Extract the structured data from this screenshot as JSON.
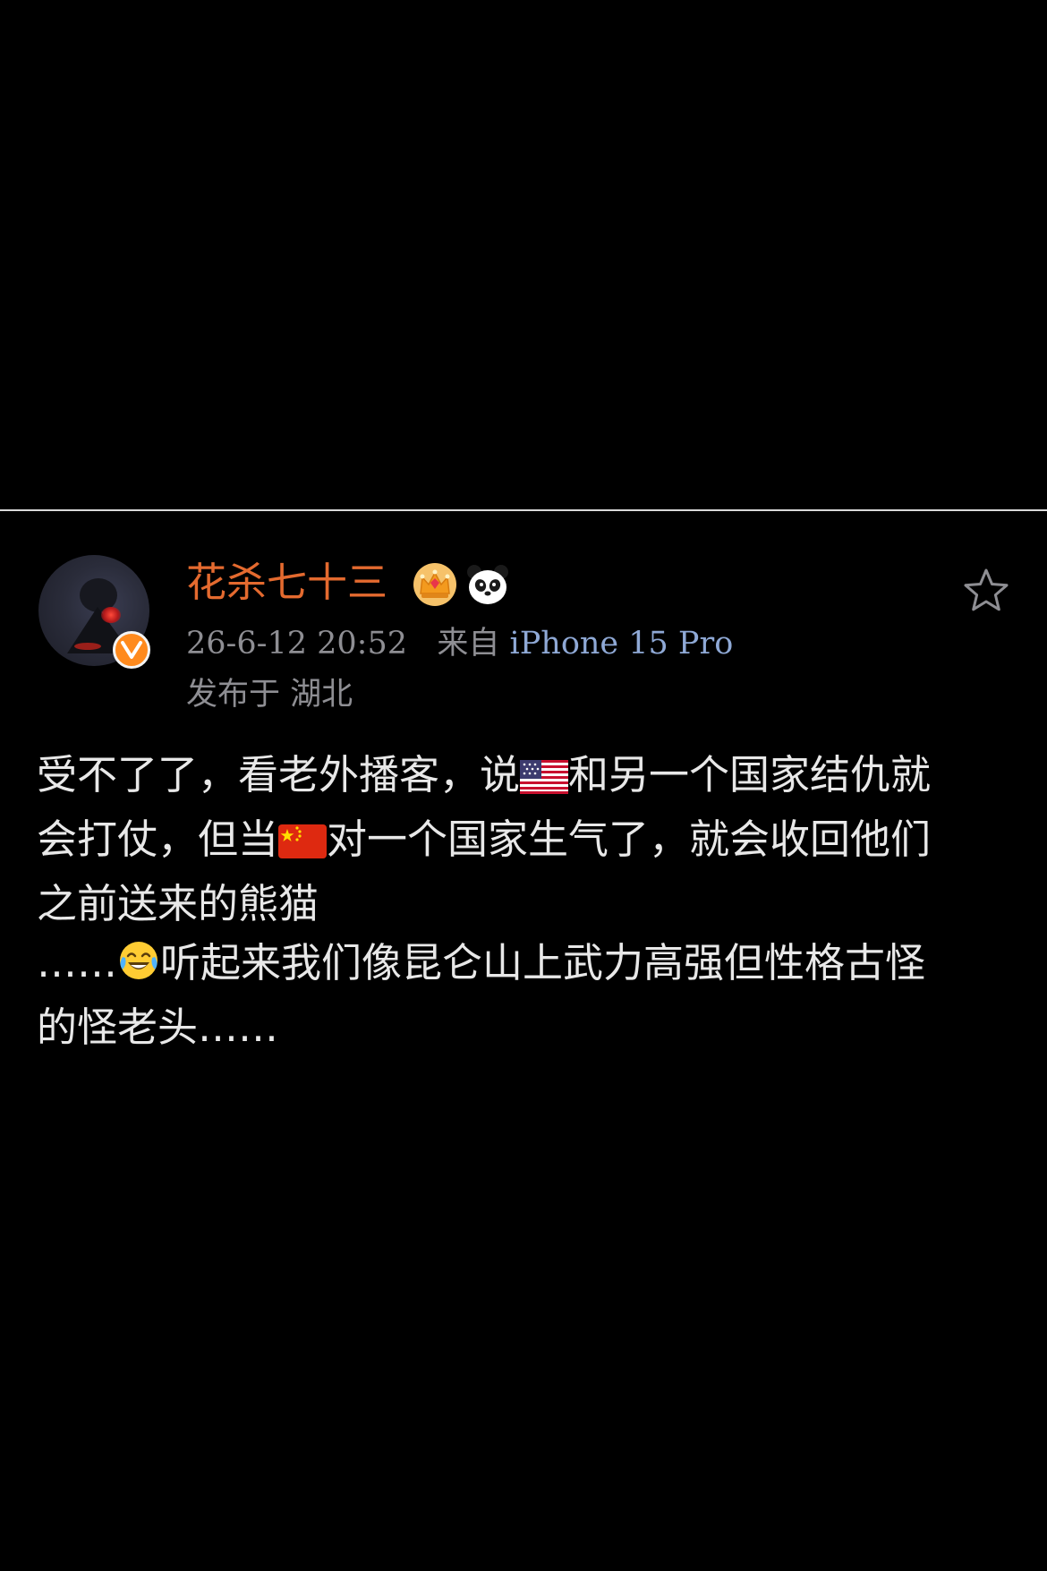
{
  "post": {
    "author": {
      "name": "花杀七十三",
      "badges": [
        "crown-icon",
        "panda-icon"
      ],
      "verified_badge": "verified-icon"
    },
    "meta": {
      "timestamp": "26-6-12 20:52",
      "source_prefix": "来自",
      "device": "iPhone 15 Pro",
      "location": "发布于 湖北"
    },
    "content": {
      "line1_a": "受不了了，看老外播客，说",
      "line1_emoji": "us-flag-icon",
      "line1_b": "和另一个国家结仇就",
      "line2_a": "会打仗，但当",
      "line2_emoji": "china-flag-icon",
      "line2_b": "对一个国家生气了，就会收回他们",
      "line3": "之前送来的熊猫",
      "line4_a": "……",
      "line4_emoji": "crying-laughing-icon",
      "line4_b": "听起来我们像昆仑山上武力高强但性格古怪",
      "line5": "的怪老头……"
    },
    "actions": {
      "favorite": "star-icon"
    }
  },
  "colors": {
    "background": "#000000",
    "username": "#e46a2f",
    "meta": "#8e8e93",
    "device_link": "#8fa9d6",
    "body_text": "#e8e8e8",
    "verified": "#ff8a1d"
  }
}
